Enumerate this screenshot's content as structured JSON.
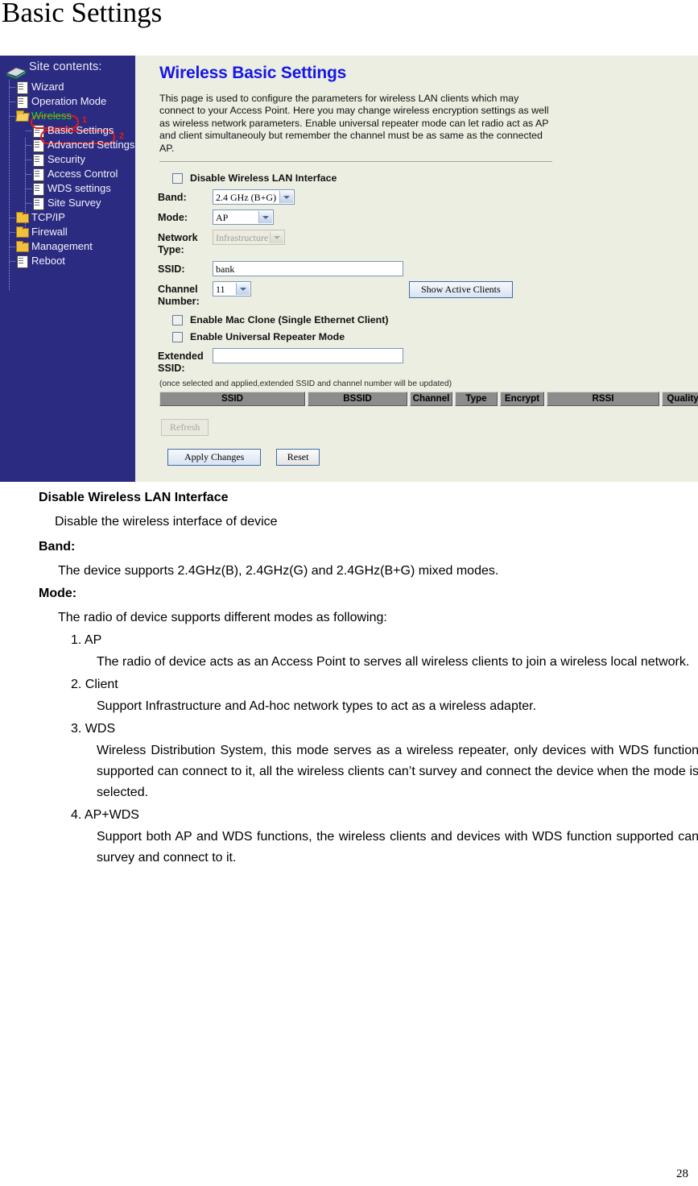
{
  "document": {
    "title": "Basic Settings",
    "page_number": "28"
  },
  "sidebar": {
    "heading": "Site contents:",
    "book_icon": "book-icon",
    "items": [
      {
        "label": "Wizard",
        "icon": "page-icon",
        "level": 1
      },
      {
        "label": "Operation Mode",
        "icon": "page-icon",
        "level": 1
      },
      {
        "label": "Wireless",
        "icon": "folder-open-icon",
        "level": 1,
        "highlighted": true
      },
      {
        "label": "Basic Settings",
        "icon": "page-icon",
        "level": 2,
        "selected": true
      },
      {
        "label": "Advanced Settings",
        "icon": "page-icon",
        "level": 2
      },
      {
        "label": "Security",
        "icon": "page-icon",
        "level": 2
      },
      {
        "label": "Access Control",
        "icon": "page-icon",
        "level": 2
      },
      {
        "label": "WDS settings",
        "icon": "page-icon",
        "level": 2
      },
      {
        "label": "Site Survey",
        "icon": "page-icon",
        "level": 2
      },
      {
        "label": "TCP/IP",
        "icon": "folder-icon",
        "level": 1
      },
      {
        "label": "Firewall",
        "icon": "folder-icon",
        "level": 1
      },
      {
        "label": "Management",
        "icon": "folder-icon",
        "level": 1
      },
      {
        "label": "Reboot",
        "icon": "page-icon",
        "level": 1
      }
    ],
    "annotations": [
      {
        "id": "1",
        "target": "Wireless"
      },
      {
        "id": "2",
        "target": "Basic Settings"
      }
    ],
    "colors": {
      "background": "#2b2b82",
      "highlight_text": "#22e022",
      "annotation": "#e01b1b"
    }
  },
  "panel": {
    "title": "Wireless Basic Settings",
    "title_color": "#1616e8",
    "description": "This page is used to configure the parameters for wireless LAN clients which may connect to your Access Point. Here you may change wireless encryption settings as well as wireless network parameters. Enable universal repeater mode can let radio act as AP and client simultaneouly but remember the channel must be as same as the connected AP.",
    "disable_wlan": {
      "label": "Disable Wireless LAN Interface",
      "checked": false
    },
    "fields": {
      "band": {
        "label": "Band:",
        "value": "2.4 GHz (B+G)"
      },
      "mode": {
        "label": "Mode:",
        "value": "AP"
      },
      "network_type": {
        "label": "Network Type:",
        "value": "Infrastructure",
        "disabled": true
      },
      "ssid": {
        "label": "SSID:",
        "value": "bank"
      },
      "channel_number": {
        "label": "Channel Number:",
        "value": "11"
      },
      "extended_ssid": {
        "label": "Extended SSID:",
        "value": ""
      }
    },
    "mac_clone": {
      "label": "Enable Mac Clone (Single Ethernet Client)",
      "checked": false
    },
    "universal_repeater": {
      "label": "Enable Universal Repeater Mode",
      "checked": false
    },
    "show_active_clients_button": "Show Active Clients",
    "hint": "(once selected and applied,extended SSID and channel number will be updated)",
    "table": {
      "columns": [
        "SSID",
        "BSSID",
        "Channel",
        "Type",
        "Encrypt",
        "RSSI",
        "Quality"
      ],
      "rows": []
    },
    "buttons": {
      "refresh": {
        "label": "Refresh",
        "disabled": true
      },
      "apply": {
        "label": "Apply Changes",
        "disabled": false
      },
      "reset": {
        "label": "Reset",
        "disabled": false
      }
    }
  },
  "doc_body": {
    "sections": [
      {
        "type": "term",
        "text": "Disable Wireless LAN Interface"
      },
      {
        "type": "indent",
        "text": "Disable the wireless interface of device"
      },
      {
        "type": "term",
        "text": "Band:"
      },
      {
        "type": "indent2",
        "text": "The device supports 2.4GHz(B), 2.4GHz(G) and 2.4GHz(B+G) mixed modes."
      },
      {
        "type": "term",
        "text": "Mode:"
      },
      {
        "type": "indent2",
        "text": "The radio of device supports different modes as following:"
      }
    ],
    "modes": [
      {
        "number": "1. AP",
        "body": "The radio of device acts as an Access Point to serves all wireless clients to join a wireless local network."
      },
      {
        "number": "2. Client",
        "body": "Support Infrastructure and Ad-hoc network types to act as a wireless adapter."
      },
      {
        "number": "3. WDS",
        "body": "Wireless Distribution System, this mode serves as a wireless repeater, only devices with WDS function supported can connect to it, all the wireless clients can’t survey and connect the device when the mode is selected."
      },
      {
        "number": "4. AP+WDS",
        "body": "Support both AP and WDS functions, the wireless clients and devices with WDS function supported can survey and connect to it."
      }
    ]
  }
}
